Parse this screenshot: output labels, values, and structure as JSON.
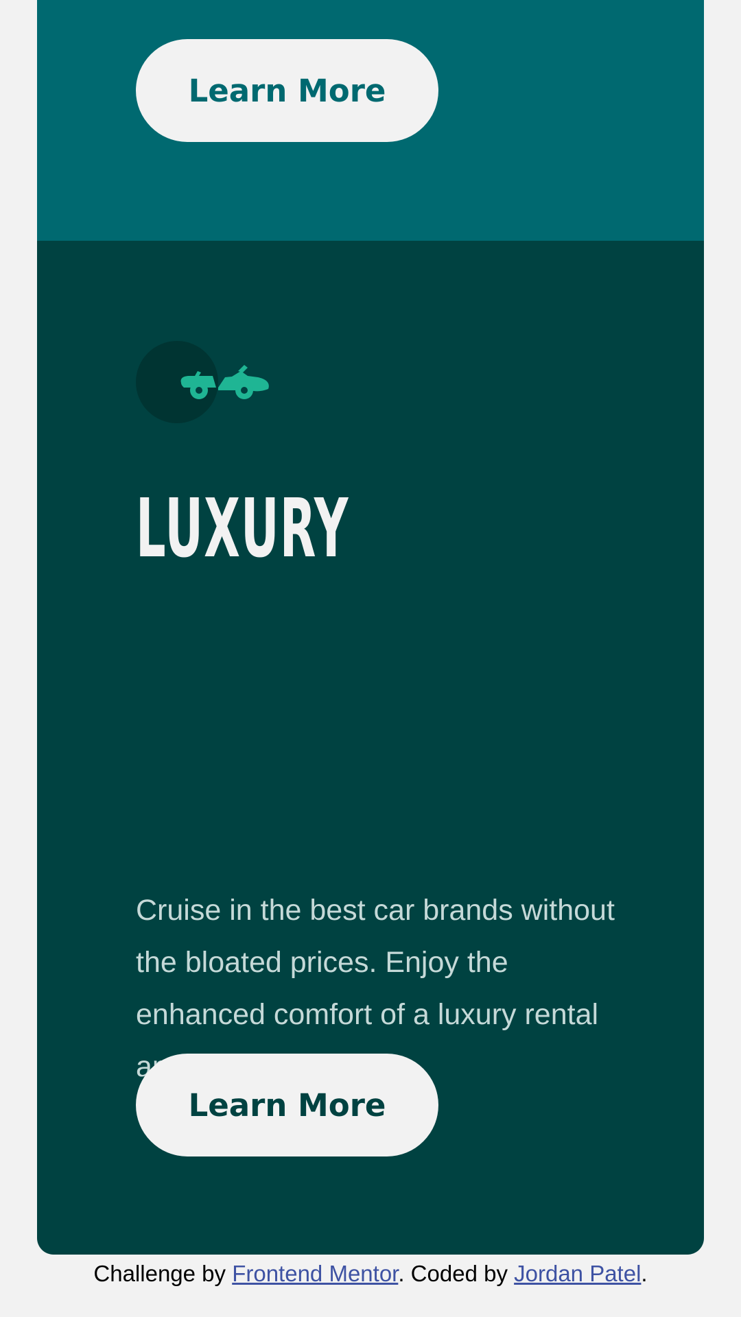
{
  "card": {
    "suv": {
      "button_label": "Learn More"
    },
    "luxury": {
      "icon": "sports-car-icon",
      "title": "LUXURY",
      "description": "Cruise in the best car brands without the bloated prices. Enjoy the enhanced comfort of a luxury rental and arrive in style.",
      "button_label": "Learn More"
    }
  },
  "footer": {
    "prefix": "Challenge by ",
    "link1": "Frontend Mentor",
    "middle": ". Coded by ",
    "link2": "Jordan Patel",
    "suffix": "."
  },
  "colors": {
    "suv_bg": "#006970",
    "luxury_bg": "#004241",
    "button_bg": "#f2f2f2",
    "icon_accent": "#1fb594",
    "page_bg": "#f2f2f2",
    "link": "#3e52a3"
  }
}
